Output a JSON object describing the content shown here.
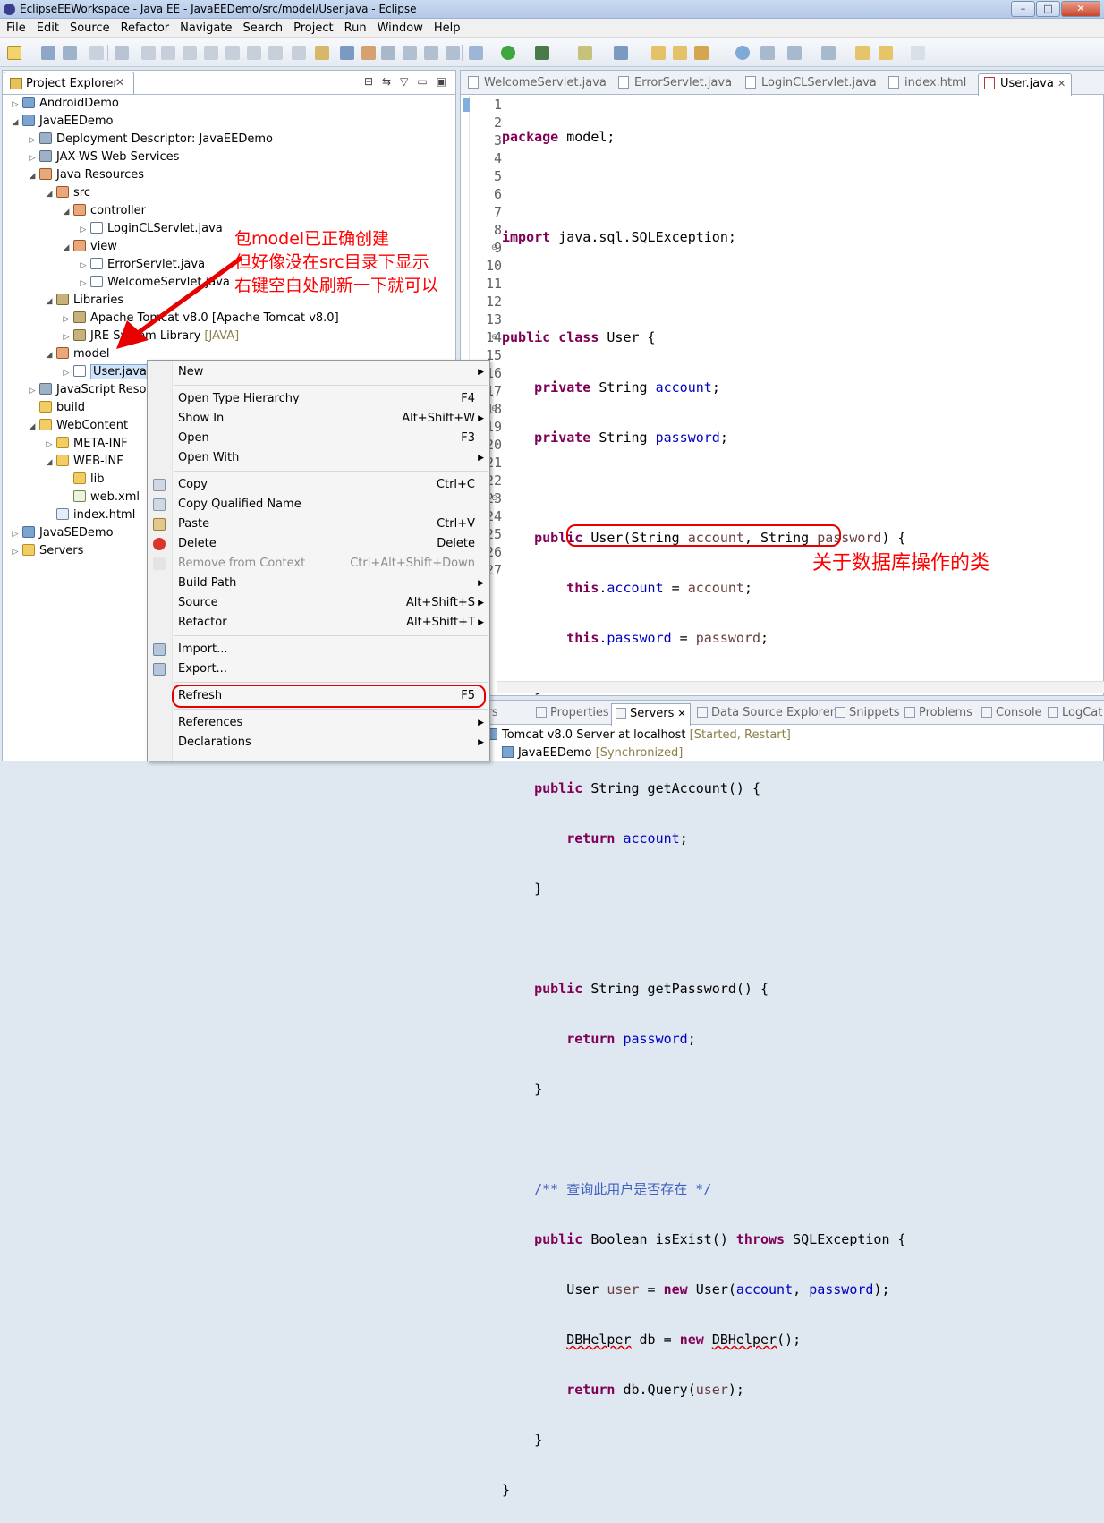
{
  "window": {
    "title": "EclipseEEWorkspace - Java EE - JavaEEDemo/src/model/User.java - Eclipse",
    "min_symbol": "–",
    "max_symbol": "□",
    "close_symbol": "✕"
  },
  "menubar": [
    "File",
    "Edit",
    "Source",
    "Refactor",
    "Navigate",
    "Search",
    "Project",
    "Run",
    "Window",
    "Help"
  ],
  "project_explorer": {
    "tab_label": "Project Explorer",
    "close_symbol": "✕",
    "tools": [
      "⊟",
      "⇆",
      "▽",
      "▭",
      "▣"
    ],
    "nodes": [
      {
        "label": "AndroidDemo",
        "twisty": "▷",
        "icon": "proj"
      },
      {
        "label": "JavaEEDemo",
        "twisty": "◢",
        "icon": "proj"
      },
      {
        "label": "Deployment Descriptor: JavaEEDemo",
        "twisty": "▷",
        "icon": "cfg"
      },
      {
        "label": "JAX-WS Web Services",
        "twisty": "▷",
        "icon": "cfg"
      },
      {
        "label": "Java Resources",
        "twisty": "◢",
        "icon": "pkg"
      },
      {
        "label": "src",
        "twisty": "◢",
        "icon": "pkg"
      },
      {
        "label": "controller",
        "twisty": "◢",
        "icon": "pkg"
      },
      {
        "label": "LoginCLServlet.java",
        "twisty": "▷",
        "icon": "java"
      },
      {
        "label": "view",
        "twisty": "◢",
        "icon": "pkg"
      },
      {
        "label": "ErrorServlet.java",
        "twisty": "▷",
        "icon": "java"
      },
      {
        "label": "WelcomeServlet.java",
        "twisty": "▷",
        "icon": "java"
      },
      {
        "label": "Libraries",
        "twisty": "◢",
        "icon": "lib"
      },
      {
        "label": "Apache Tomcat v8.0 [Apache Tomcat v8.0]",
        "twisty": "▷",
        "icon": "lib"
      },
      {
        "label": "JRE System Library",
        "suffix": "[JAVA]",
        "twisty": "▷",
        "icon": "lib"
      },
      {
        "label": "model",
        "twisty": "◢",
        "icon": "pkg"
      },
      {
        "label": "User.java",
        "twisty": "▷",
        "icon": "java",
        "selected": true
      },
      {
        "label": "JavaScript Resources",
        "twisty": "▷",
        "icon": "cfg"
      },
      {
        "label": "build",
        "twisty": "",
        "icon": "folder"
      },
      {
        "label": "WebContent",
        "twisty": "◢",
        "icon": "folder"
      },
      {
        "label": "META-INF",
        "twisty": "▷",
        "icon": "folder"
      },
      {
        "label": "WEB-INF",
        "twisty": "◢",
        "icon": "folder"
      },
      {
        "label": "lib",
        "twisty": "",
        "icon": "folder"
      },
      {
        "label": "web.xml",
        "twisty": "",
        "icon": "xml"
      },
      {
        "label": "index.html",
        "twisty": "",
        "icon": "html"
      },
      {
        "label": "JavaSEDemo",
        "twisty": "▷",
        "icon": "proj"
      },
      {
        "label": "Servers",
        "twisty": "▷",
        "icon": "folder"
      }
    ]
  },
  "editor": {
    "tabs": [
      "WelcomeServlet.java",
      "ErrorServlet.java",
      "LoginCLServlet.java",
      "index.html",
      "User.java"
    ],
    "active_tab_close": "✕",
    "fold_symbol": "⊖",
    "line_numbers": [
      "1",
      "2",
      "3",
      "4",
      "5",
      "6",
      "7",
      "8",
      "9",
      "10",
      "11",
      "12",
      "13",
      "14",
      "15",
      "16",
      "17",
      "18",
      "19",
      "20",
      "21",
      "22",
      "23",
      "24",
      "25",
      "26",
      "27"
    ],
    "code": {
      "l1_kw": "package",
      "l1_rest": " model;",
      "l3_kw": "import",
      "l3_rest": " java.sql.SQLException;",
      "l5_kw1": "public",
      "l5_kw2": "class",
      "l5_rest": " User {",
      "l6_kw": "private",
      "l6_type": " String ",
      "l6_fld": "account",
      "l6_end": ";",
      "l7_kw": "private",
      "l7_type": " String ",
      "l7_fld": "password",
      "l7_end": ";",
      "l9_kw": "public",
      "l9_a": " User(String ",
      "l9_p1": "account",
      "l9_b": ", String ",
      "l9_p2": "password",
      "l9_c": ") {",
      "l10_kw": "this",
      "l10_a": ".",
      "l10_fld": "account",
      "l10_b": " = ",
      "l10_p": "account",
      "l10_c": ";",
      "l11_kw": "this",
      "l11_a": ".",
      "l11_fld": "password",
      "l11_b": " = ",
      "l11_p": "password",
      "l11_c": ";",
      "close_brace": "}",
      "l14_kw": "public",
      "l14_rest": " String getAccount() {",
      "l15_kw": "return",
      "l15_fld": "account",
      "l15_end": ";",
      "l18_kw": "public",
      "l18_rest": " String getPassword() {",
      "l19_kw": "return",
      "l19_fld": "password",
      "l19_end": ";",
      "l22_cmt": "/** 查询此用户是否存在 */",
      "l23_kw1": "public",
      "l23_a": " Boolean isExist() ",
      "l23_kw2": "throws",
      "l23_b": " SQLException {",
      "l24_a": "User ",
      "l24_v": "user",
      "l24_b": " = ",
      "l24_kw": "new",
      "l24_c": " User(",
      "l24_f1": "account",
      "l24_d": ", ",
      "l24_f2": "password",
      "l24_e": ");",
      "l25_a": "DBHelper",
      "l25_b": " db = ",
      "l25_kw": "new",
      "l25_c": " ",
      "l25_d": "DBHelper",
      "l25_e": "();",
      "l26_kw": "return",
      "l26_a": " db.Query(",
      "l26_v": "user",
      "l26_b": ");",
      "l27": "}"
    }
  },
  "bottom_panel": {
    "tabs": [
      "Markers",
      "Properties",
      "Servers",
      "Data Source Explorer",
      "Snippets",
      "Problems",
      "Console",
      "LogCat"
    ],
    "active_close": "✕",
    "servers": [
      {
        "name": "Tomcat v8.0 Server at localhost",
        "state": "[Started, Restart]"
      },
      {
        "name": "JavaEEDemo",
        "state": "[Synchronized]"
      }
    ]
  },
  "context_menu": {
    "items": [
      {
        "label": "New",
        "shortcut": "",
        "submenu": true
      },
      {
        "label": "Open Type Hierarchy",
        "shortcut": "F4"
      },
      {
        "label": "Show In",
        "shortcut": "Alt+Shift+W",
        "submenu": true
      },
      {
        "label": "Open",
        "shortcut": "F3"
      },
      {
        "label": "Open With",
        "shortcut": "",
        "submenu": true
      },
      {
        "label": "Copy",
        "shortcut": "Ctrl+C"
      },
      {
        "label": "Copy Qualified Name",
        "shortcut": ""
      },
      {
        "label": "Paste",
        "shortcut": "Ctrl+V"
      },
      {
        "label": "Delete",
        "shortcut": "Delete"
      },
      {
        "label": "Remove from Context",
        "shortcut": "Ctrl+Alt+Shift+Down",
        "disabled": true
      },
      {
        "label": "Build Path",
        "shortcut": "",
        "submenu": true
      },
      {
        "label": "Source",
        "shortcut": "Alt+Shift+S",
        "submenu": true
      },
      {
        "label": "Refactor",
        "shortcut": "Alt+Shift+T",
        "submenu": true
      },
      {
        "label": "Import...",
        "shortcut": ""
      },
      {
        "label": "Export...",
        "shortcut": ""
      },
      {
        "label": "Refresh",
        "shortcut": "F5"
      },
      {
        "label": "References",
        "shortcut": "",
        "submenu": true
      },
      {
        "label": "Declarations",
        "shortcut": "",
        "submenu": true
      }
    ],
    "submenu_arrow": "▶"
  },
  "annotations": {
    "note1_line1": "包model已正确创建",
    "note1_line2": "但好像没在src目录下显示",
    "note1_line3": "右键空白处刷新一下就可以",
    "note2": "关于数据库操作的类"
  },
  "colors": {
    "keyword": "#7f0055",
    "field": "#0000c0",
    "comment": "#3f5fbf",
    "annotation_red": "#ff0000"
  }
}
